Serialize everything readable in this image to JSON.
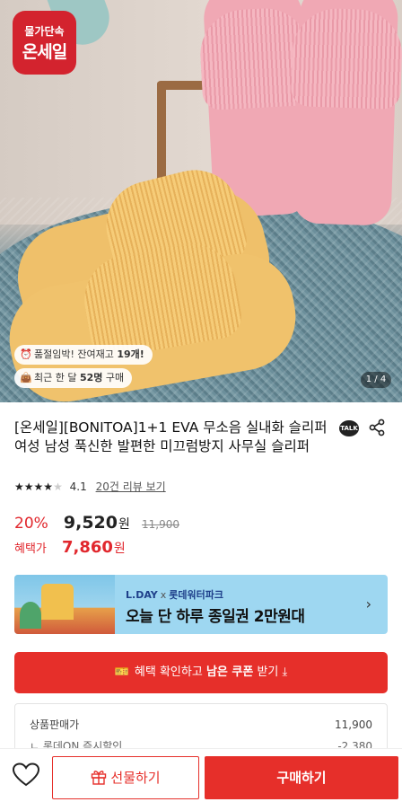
{
  "hero": {
    "logo_top": "물가단속",
    "logo_main": "온세일",
    "stock_chip": {
      "prefix": "품절임박! 잔여재고 ",
      "count": "19개!"
    },
    "sold_chip": {
      "prefix": "최근 한 달 ",
      "count": "52명",
      "suffix": " 구매"
    },
    "pager": "1 / 4"
  },
  "product": {
    "title": "[온세일][BONITOA]1+1 EVA 무소음 실내화 슬리퍼 여성 남성 푹신한 발편한 미끄럼방지 사무실 슬리퍼",
    "talk_label": "TALK",
    "rating": {
      "stars_full": 4,
      "stars_total": 5,
      "score": "4.1",
      "reviews": "20건 리뷰 보기"
    },
    "price": {
      "discount_rate": "20%",
      "sale_price": "9,520",
      "won": "원",
      "original_price": "11,900"
    },
    "benefit": {
      "label": "혜택가",
      "price": "7,860",
      "won": "원"
    }
  },
  "banner": {
    "brand": "L.DAY",
    "x": "x",
    "partner": "롯데워터파크",
    "headline": "오늘 단 하루 종일권 2만원대",
    "chevron": "›"
  },
  "coupon": {
    "prefix": "혜택 확인하고 ",
    "bold": "남은 쿠폰",
    "suffix": " 받기 ⤓"
  },
  "breakdown": {
    "rows": [
      {
        "label": "상품판매가",
        "value": "11,900"
      },
      {
        "label": "ㄴ 롯데ON 즉시할인",
        "value": "-2,380"
      }
    ]
  },
  "bottom_bar": {
    "gift_label": "선물하기",
    "buy_label": "구매하기"
  },
  "colors": {
    "accent": "#e62f2a",
    "logo": "#d3232e",
    "banner_bg": "#9ed7f1"
  }
}
